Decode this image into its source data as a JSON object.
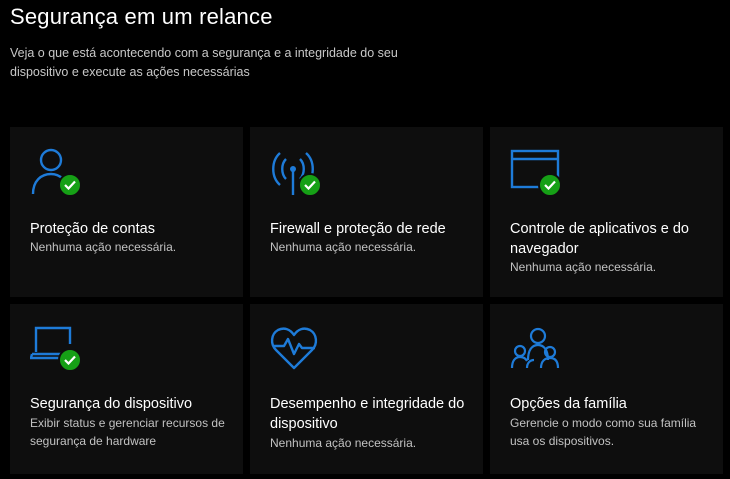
{
  "header": {
    "title": "Segurança em um relance",
    "subtitle": "Veja o que está acontecendo com a segurança e a integridade do seu dispositivo e execute as ações necessárias"
  },
  "colors": {
    "accent": "#1e7bd8",
    "check_green": "#16a016",
    "card_bg": "#0e0e0e",
    "page_bg": "#000000"
  },
  "cards": [
    {
      "title": "Proteção de contas",
      "desc": "Nenhuma ação necessária.",
      "icon": "person-icon",
      "status": "ok"
    },
    {
      "title": "Firewall e proteção de rede",
      "desc": "Nenhuma ação necessária.",
      "icon": "antenna-icon",
      "status": "ok"
    },
    {
      "title": "Controle de aplicativos e do navegador",
      "desc": "Nenhuma ação necessária.",
      "icon": "browser-window-icon",
      "status": "ok"
    },
    {
      "title": "Segurança do dispositivo",
      "desc": "Exibir status e gerenciar recursos de segurança de hardware",
      "icon": "laptop-icon",
      "status": "ok"
    },
    {
      "title": "Desempenho e integridade do dispositivo",
      "desc": "Nenhuma ação necessária.",
      "icon": "heart-pulse-icon",
      "status": "none"
    },
    {
      "title": "Opções da família",
      "desc": "Gerencie o modo como sua família usa os dispositivos.",
      "icon": "family-icon",
      "status": "none"
    }
  ]
}
